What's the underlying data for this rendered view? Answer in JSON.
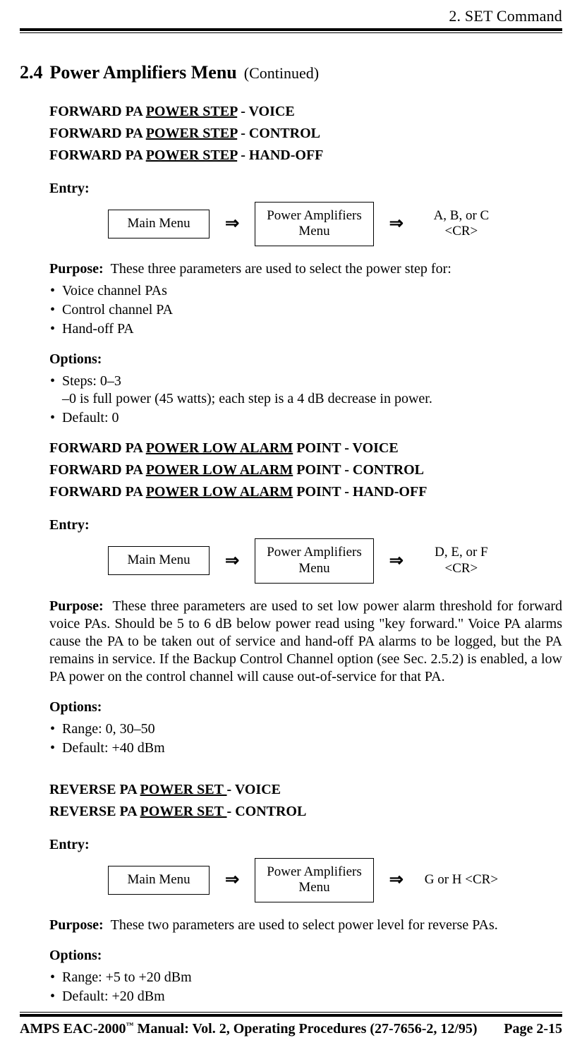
{
  "header": {
    "running": "2.   SET Command"
  },
  "section": {
    "number": "2.4",
    "title": "Power Amplifiers Menu",
    "continued": "(Continued)"
  },
  "groups": [
    {
      "headings": [
        {
          "pre": "FORWARD PA ",
          "u": "POWER STEP",
          "post": " - VOICE"
        },
        {
          "pre": "FORWARD PA ",
          "u": "POWER STEP",
          "post": " - CONTROL"
        },
        {
          "pre": "FORWARD PA ",
          "u": "POWER STEP",
          "post": " - HAND-OFF"
        }
      ],
      "entryLabel": "Entry:",
      "flow": {
        "box1": "Main Menu",
        "box2": "Power Amplifiers\nMenu",
        "tailTop": "A, B, or C",
        "tailBot": "<CR>"
      },
      "purposeLabel": "Purpose:",
      "purposeText": "These three parameters are used to select the power step for:",
      "purposeBullets": [
        "Voice channel PAs",
        "Control channel PA",
        "Hand-off PA"
      ],
      "optionsLabel": "Options:",
      "optionsBullets": [
        "Steps:  0–3",
        "Default:  0"
      ],
      "optionsSubline": "–0 is full power (45 watts); each step is a 4 dB decrease in power."
    },
    {
      "headings": [
        {
          "pre": "FORWARD PA ",
          "u": "POWER LOW ALARM",
          "post": " POINT - VOICE"
        },
        {
          "pre": "FORWARD PA ",
          "u": "POWER LOW ALARM",
          "post": " POINT - CONTROL"
        },
        {
          "pre": "FORWARD PA ",
          "u": "POWER LOW ALARM",
          "post": " POINT - HAND-OFF"
        }
      ],
      "entryLabel": "Entry:",
      "flow": {
        "box1": "Main Menu",
        "box2": "Power Amplifiers\nMenu",
        "tailTop": "D, E, or F",
        "tailBot": "<CR>"
      },
      "purposeLabel": "Purpose:",
      "purposeText": "These three parameters are used to set low power alarm threshold for forward voice PAs.  Should be 5 to 6 dB below power read using \"key forward.\"  Voice PA alarms cause the PA to be taken out of service and hand-off PA alarms to be logged, but the PA remains in service.  If the Backup Control Channel option (see Sec. 2.5.2) is enabled, a low PA power on the control channel will cause out-of-service for that PA.",
      "optionsLabel": "Options:",
      "optionsBullets": [
        "Range:  0, 30–50",
        "Default:  +40 dBm"
      ]
    },
    {
      "headings": [
        {
          "pre": "REVERSE PA ",
          "u": "POWER SET ",
          "post": "- VOICE"
        },
        {
          "pre": "REVERSE PA ",
          "u": "POWER SET ",
          "post": "- CONTROL"
        }
      ],
      "entryLabel": "Entry:",
      "flow": {
        "box1": "Main Menu",
        "box2": "Power Amplifiers\nMenu",
        "tailTop": "G or H <CR>",
        "tailBot": ""
      },
      "purposeLabel": "Purpose:",
      "purposeText": "These two parameters are used to select power level for reverse PAs.",
      "optionsLabel": "Options:",
      "optionsBullets": [
        "Range:  +5 to +20 dBm",
        "Default:  +20 dBm"
      ]
    }
  ],
  "footer": {
    "left_pre": "AMPS EAC-2000",
    "left_post": " Manual:  Vol. 2, Operating Procedures (27-7656-2, 12/95)",
    "right": "Page 2-15"
  }
}
